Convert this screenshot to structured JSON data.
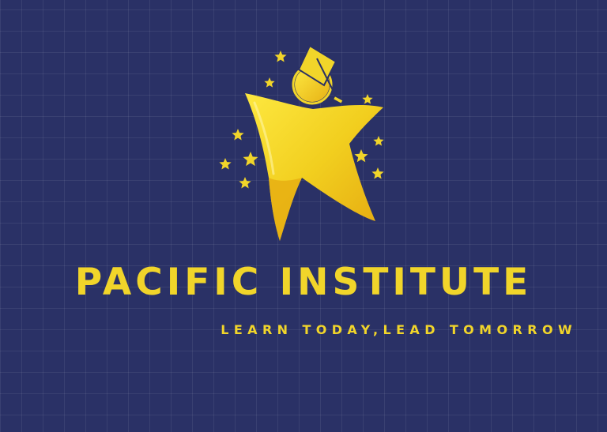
{
  "brand": {
    "name": "PACIFIC INSTITUTE",
    "tagline": "LEARN TODAY,LEAD TOMORROW"
  },
  "icons": {
    "mark": "graduate-star-figure-icon",
    "decoration": "star-icon",
    "cap": "graduation-cap-icon"
  },
  "colors": {
    "background": "#2a3166",
    "grid": "#3a4178",
    "brand_yellow": "#f1d52a",
    "star_light": "#f7e03c",
    "star_mid": "#f2cf1f",
    "star_dark": "#e4a810"
  }
}
